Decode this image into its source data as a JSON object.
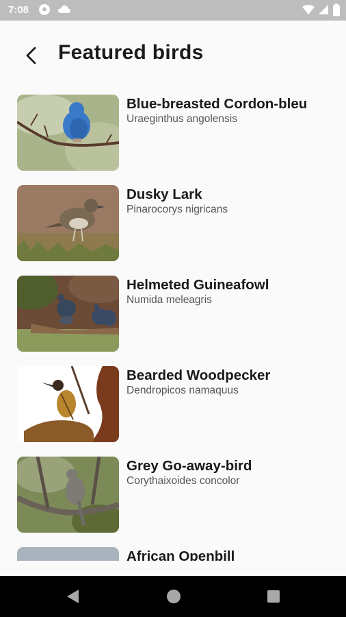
{
  "status_bar": {
    "time": "7:08"
  },
  "header": {
    "title": "Featured birds"
  },
  "birds": [
    {
      "name": "Blue-breasted Cordon-bleu",
      "scientific": "Uraeginthus angolensis"
    },
    {
      "name": "Dusky Lark",
      "scientific": "Pinarocorys nigricans"
    },
    {
      "name": "Helmeted Guineafowl",
      "scientific": "Numida meleagris"
    },
    {
      "name": "Bearded Woodpecker",
      "scientific": "Dendropicos namaquus"
    },
    {
      "name": "Grey Go-away-bird",
      "scientific": "Corythaixoides concolor"
    },
    {
      "name": "African Openbill",
      "scientific": ""
    }
  ],
  "colors": {
    "accent_text": "#1a1a1a",
    "status_bar": "#bdbdbd",
    "nav_bar": "#000000"
  }
}
